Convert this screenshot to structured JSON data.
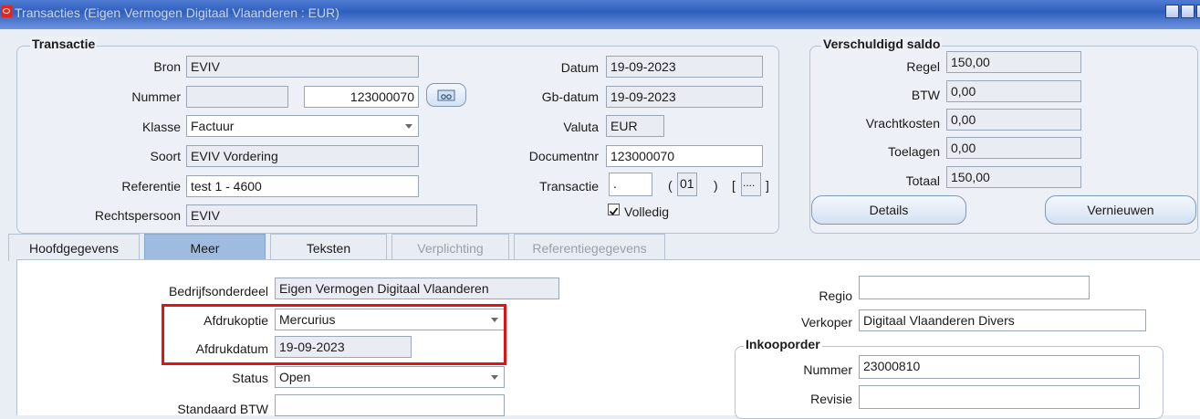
{
  "window": {
    "title": "Transacties (Eigen Vermogen Digitaal Vlaanderen : EUR)"
  },
  "transactie": {
    "title": "Transactie",
    "bron": {
      "label": "Bron",
      "value": "EVIV"
    },
    "nummer": {
      "label": "Nummer",
      "value1": "",
      "value2": "123000070"
    },
    "klasse": {
      "label": "Klasse",
      "value": "Factuur"
    },
    "soort": {
      "label": "Soort",
      "value": "EVIV Vordering"
    },
    "referentie": {
      "label": "Referentie",
      "value": "test 1 - 4600"
    },
    "rechtspersoon": {
      "label": "Rechtspersoon",
      "value": "EVIV"
    },
    "datum": {
      "label": "Datum",
      "value": "19-09-2023"
    },
    "gbdatum": {
      "label": "Gb-datum",
      "value": "19-09-2023"
    },
    "valuta": {
      "label": "Valuta",
      "value": "EUR"
    },
    "documentnr": {
      "label": "Documentnr",
      "value": "123000070"
    },
    "transactie_field": {
      "label": "Transactie",
      "value": ".",
      "paren_open": "(",
      "number": "01",
      "paren_close": ")",
      "bracket_open": "[",
      "dots": "....",
      "bracket_close": "]"
    },
    "volledig": {
      "label": "Volledig",
      "checked": true
    }
  },
  "saldo": {
    "title": "Verschuldigd saldo",
    "regel": {
      "label": "Regel",
      "value": "150,00"
    },
    "btw": {
      "label": "BTW",
      "value": "0,00"
    },
    "vrachtkosten": {
      "label": "Vrachtkosten",
      "value": "0,00"
    },
    "toelagen": {
      "label": "Toelagen",
      "value": "0,00"
    },
    "totaal": {
      "label": "Totaal",
      "value": "150,00"
    },
    "details_button": "Details",
    "vernieuwen_button": "Vernieuwen"
  },
  "tabs": [
    {
      "label": "Hoofdgegevens",
      "state": "normal"
    },
    {
      "label": "Meer",
      "state": "active"
    },
    {
      "label": "Teksten",
      "state": "normal"
    },
    {
      "label": "Verplichting",
      "state": "disabled"
    },
    {
      "label": "Referentiegegevens",
      "state": "disabled"
    }
  ],
  "meer": {
    "bedrijfsonderdeel": {
      "label": "Bedrijfsonderdeel",
      "value": "Eigen Vermogen Digitaal Vlaanderen"
    },
    "afdrukoptie": {
      "label": "Afdrukoptie",
      "value": "Mercurius"
    },
    "afdrukdatum": {
      "label": "Afdrukdatum",
      "value": "19-09-2023"
    },
    "status": {
      "label": "Status",
      "value": "Open"
    },
    "standaard_btw": {
      "label": "Standaard BTW",
      "value": ""
    },
    "regio": {
      "label": "Regio",
      "value": ""
    },
    "verkoper": {
      "label": "Verkoper",
      "value": "Digitaal Vlaanderen Divers"
    },
    "inkooporder": {
      "title": "Inkooporder",
      "nummer": {
        "label": "Nummer",
        "value": "23000810"
      },
      "revisie": {
        "label": "Revisie",
        "value": ""
      }
    }
  },
  "colors": {
    "highlight": "#e01414",
    "title_bar": "#2f5fbe",
    "active_tab": "#9fbbe0"
  }
}
